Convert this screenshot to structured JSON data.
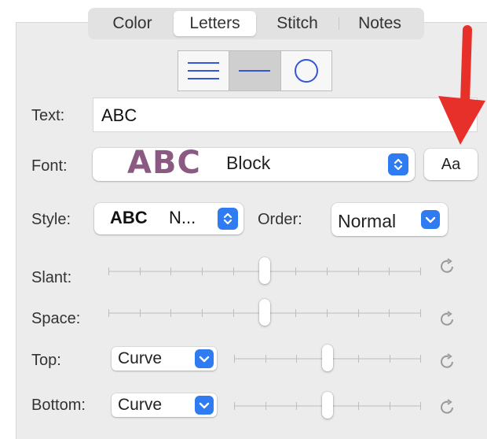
{
  "tabs": [
    {
      "label": "Color",
      "selected": false
    },
    {
      "label": "Letters",
      "selected": true
    },
    {
      "label": "Stitch",
      "selected": false
    },
    {
      "label": "Notes",
      "selected": false
    }
  ],
  "modes": [
    {
      "icon": "horizontal-lines-icon",
      "selected": false
    },
    {
      "icon": "single-line-icon",
      "selected": true
    },
    {
      "icon": "circle-icon",
      "selected": false
    }
  ],
  "text_field": {
    "label": "Text:",
    "value": "ABC"
  },
  "font": {
    "label": "Font:",
    "preview": "ABC",
    "name": "Block",
    "button": "Aa",
    "preview_color": "#8a5a82"
  },
  "style": {
    "label": "Style:",
    "preview": "ABC",
    "name": "N..."
  },
  "order": {
    "label": "Order:",
    "value": "Normal"
  },
  "sliders": {
    "slant": {
      "label": "Slant:",
      "value": 0.5
    },
    "space": {
      "label": "Space:",
      "value": 0.5
    },
    "top": {
      "label": "Top:",
      "shape": "Curve",
      "value": 0.5
    },
    "bottom": {
      "label": "Bottom:",
      "shape": "Curve",
      "value": 0.5
    }
  },
  "colors": {
    "accent": "#2f7bf2",
    "annotation_arrow": "#e8302a"
  }
}
